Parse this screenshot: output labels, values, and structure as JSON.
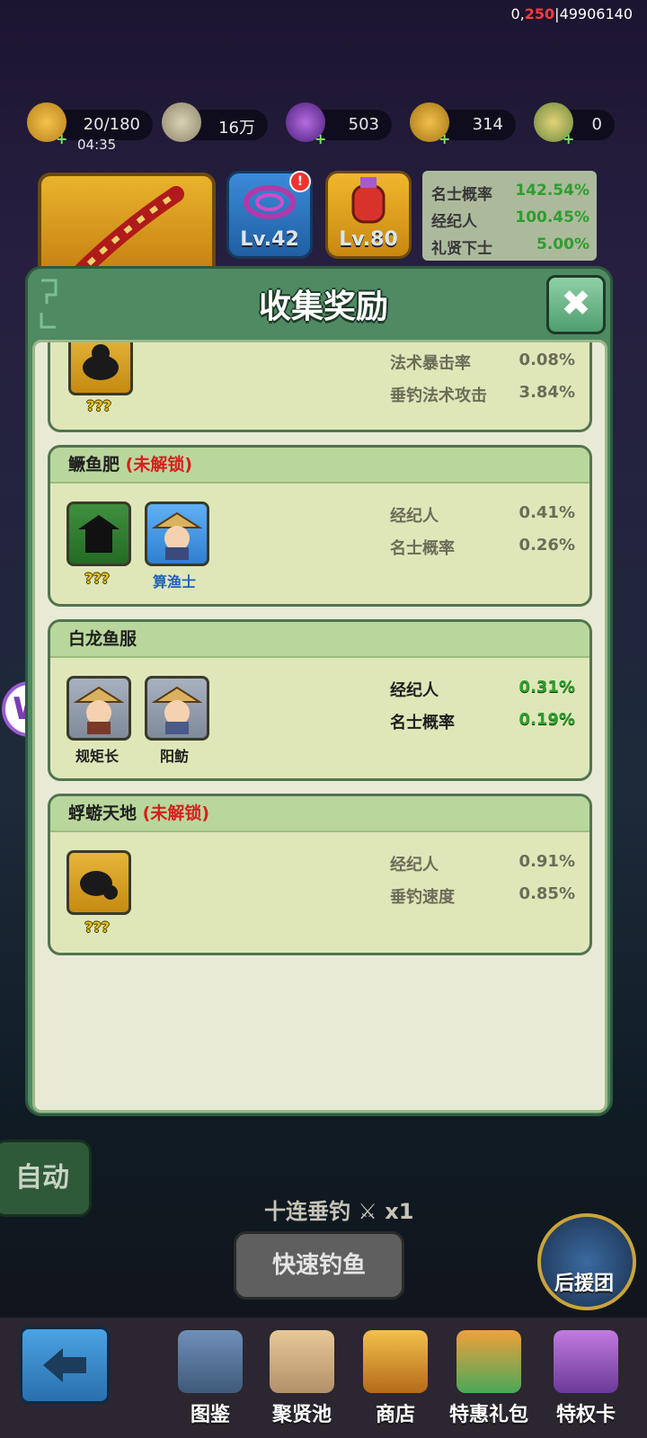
{
  "top_id": {
    "prefix": "0,",
    "highlight": "250",
    "suffix": "|49906140"
  },
  "resources": {
    "stamina": {
      "value": "20/180",
      "timer": "04:35"
    },
    "coins": {
      "value": "16万"
    },
    "gems": {
      "value": "503"
    },
    "tokens": {
      "value": "314"
    },
    "sword": {
      "value": "0"
    },
    "plus": "+"
  },
  "top_cards": {
    "rope_level": "Lv.42",
    "potion_level": "Lv.80",
    "alert": "!"
  },
  "top_stats": [
    {
      "label": "名士概率",
      "value": "142.54%"
    },
    {
      "label": "经纪人",
      "value": "100.45%"
    },
    {
      "label": "礼贤下士",
      "value": "5.00%"
    }
  ],
  "modal": {
    "title": "收集奖励",
    "close": "✖"
  },
  "sections": [
    {
      "title": "",
      "locked_label": "",
      "slots": [
        {
          "name": "???"
        }
      ],
      "stats": [
        {
          "label": "法术暴击率",
          "value": "0.08%"
        },
        {
          "label": "垂钓法术攻击",
          "value": "3.84%"
        }
      ]
    },
    {
      "title": "鳜鱼肥",
      "locked_label": "(未解锁)",
      "slots": [
        {
          "name": "???"
        },
        {
          "name": "算渔士"
        }
      ],
      "stats": [
        {
          "label": "经纪人",
          "value": "0.41%"
        },
        {
          "label": "名士概率",
          "value": "0.26%"
        }
      ]
    },
    {
      "title": "白龙鱼服",
      "locked_label": "",
      "slots": [
        {
          "name": "规矩长"
        },
        {
          "name": "阳鲂"
        }
      ],
      "stats": [
        {
          "label": "经纪人",
          "value": "0.31%"
        },
        {
          "label": "名士概率",
          "value": "0.19%"
        }
      ]
    },
    {
      "title": "蜉蝣天地",
      "locked_label": "(未解锁)",
      "slots": [
        {
          "name": "???"
        }
      ],
      "stats": [
        {
          "label": "经纪人",
          "value": "0.91%"
        },
        {
          "label": "垂钓速度",
          "value": "0.85%"
        }
      ]
    }
  ],
  "controls": {
    "auto": "自动",
    "ten_pull": "十连垂钓",
    "ten_pull_count": "x1",
    "quick_fish": "快速钓鱼",
    "support": "后援团"
  },
  "nav": [
    {
      "label": "图鉴",
      "icon": "book-icon"
    },
    {
      "label": "聚贤池",
      "icon": "map-icon"
    },
    {
      "label": "商店",
      "icon": "shop-icon"
    },
    {
      "label": "特惠礼包",
      "icon": "gift-icon"
    },
    {
      "label": "特权卡",
      "icon": "card-icon"
    }
  ],
  "floating": "W"
}
